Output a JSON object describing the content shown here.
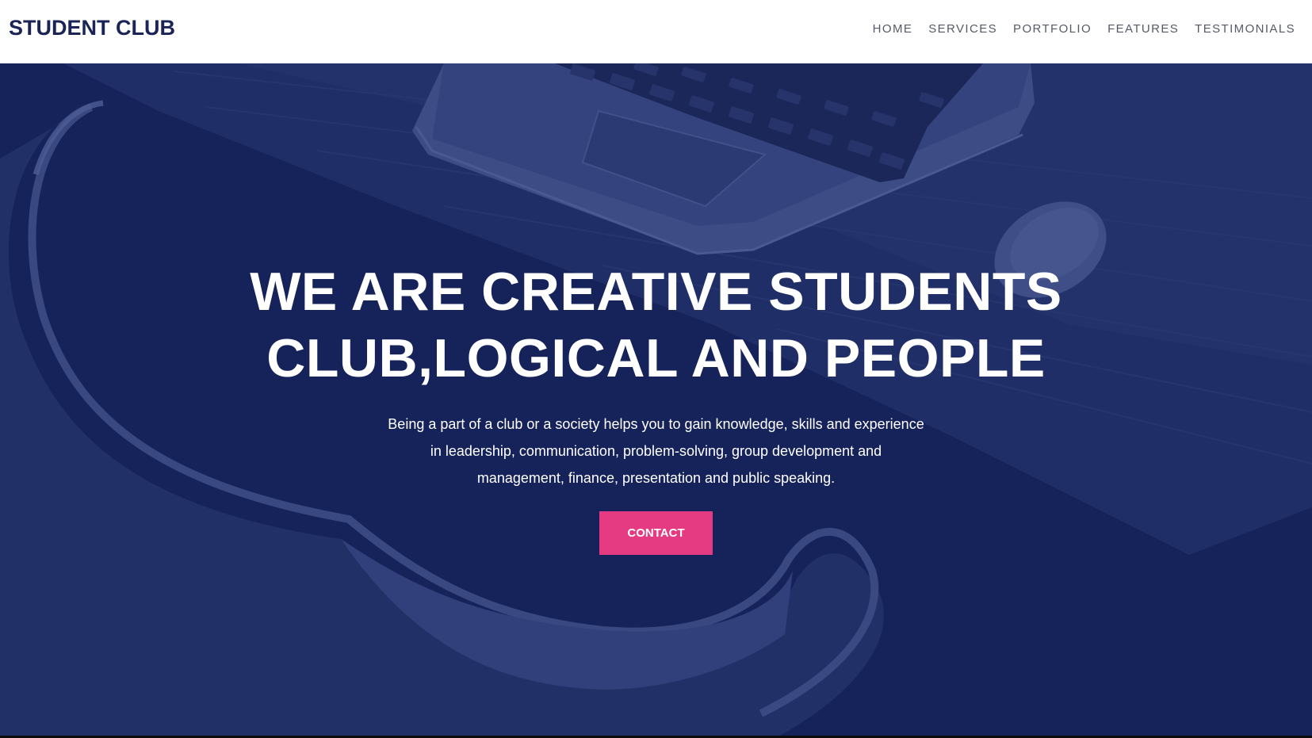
{
  "header": {
    "brand": "STUDENT CLUB",
    "nav": [
      {
        "label": "HOME"
      },
      {
        "label": "SERVICES"
      },
      {
        "label": "PORTFOLIO"
      },
      {
        "label": "FEATURES"
      },
      {
        "label": "TESTIMONIALS"
      }
    ]
  },
  "hero": {
    "title_line1": "WE ARE CREATIVE STUDENTS",
    "title_line2": "CLUB,LOGICAL AND PEOPLE",
    "text_line1": "Being a part of a club or a society helps you to gain knowledge, skills and experience",
    "text_line2": "in leadership, communication, problem-solving, group development and",
    "text_line3": "management, finance, presentation and public speaking.",
    "button_label": "CONTACT"
  },
  "colors": {
    "brand": "#1a2456",
    "hero_overlay": "#16235a",
    "accent": "#e43b82",
    "nav_text": "#555a66"
  }
}
